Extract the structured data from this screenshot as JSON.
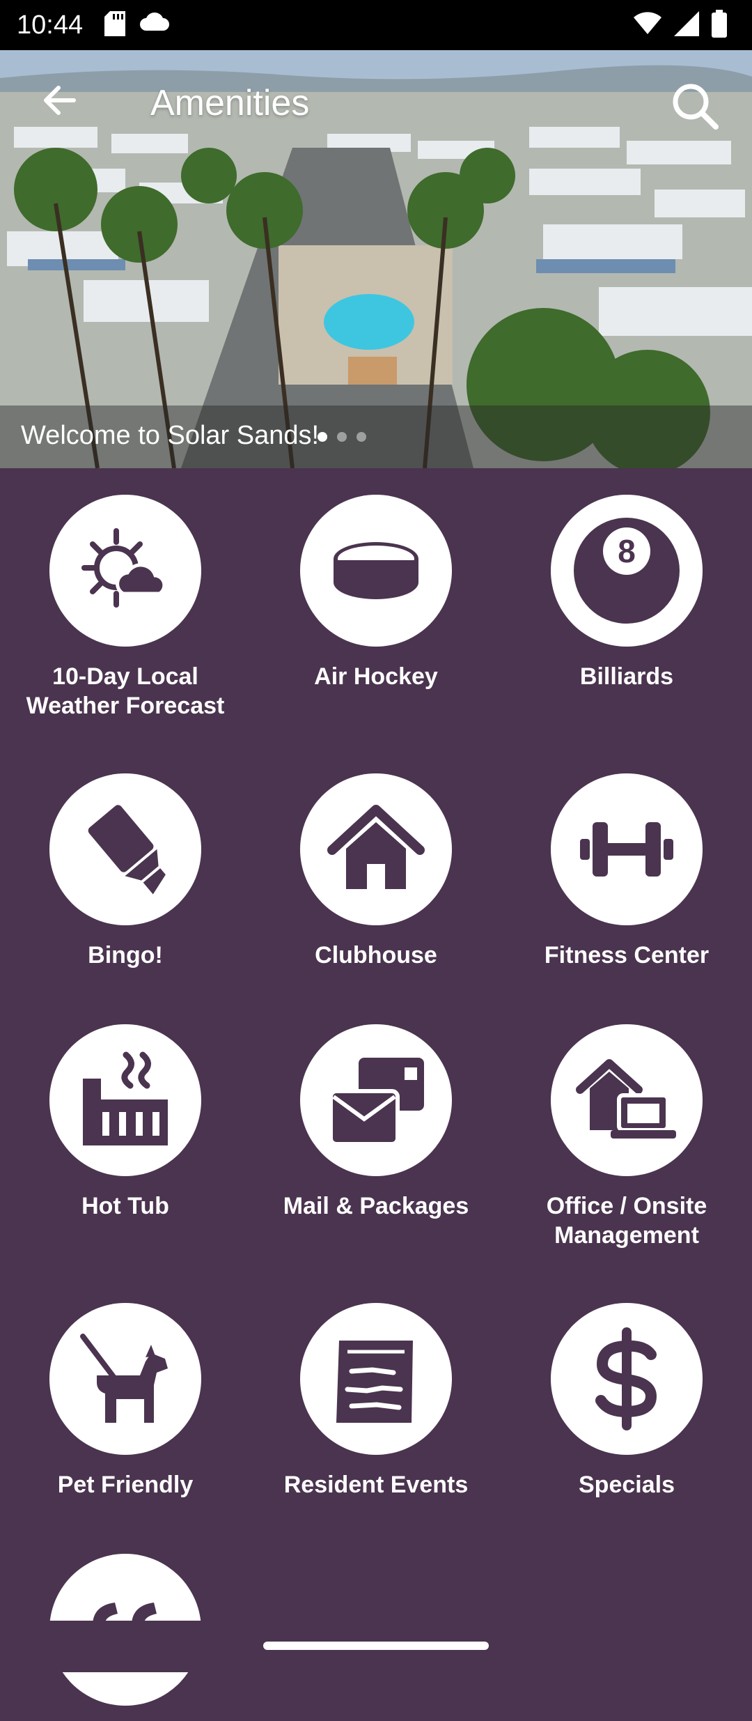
{
  "status": {
    "time": "10:44"
  },
  "header": {
    "title": "Amenities"
  },
  "hero": {
    "caption": "Welcome to Solar Sands!",
    "dot_count": 3,
    "active_dot": 0
  },
  "colors": {
    "background": "#4b344f",
    "icon": "#4b344f",
    "tile": "#ffffff"
  },
  "amenities": [
    {
      "label": "10-Day Local Weather Forecast",
      "icon": "weather-icon"
    },
    {
      "label": "Air Hockey",
      "icon": "puck-icon"
    },
    {
      "label": "Billiards",
      "icon": "eight-ball-icon"
    },
    {
      "label": "Bingo!",
      "icon": "highlighter-icon"
    },
    {
      "label": "Clubhouse",
      "icon": "house-icon"
    },
    {
      "label": "Fitness Center",
      "icon": "dumbbell-icon"
    },
    {
      "label": "Hot Tub",
      "icon": "hot-tub-icon"
    },
    {
      "label": "Mail & Packages",
      "icon": "mail-icon"
    },
    {
      "label": "Office / Onsite Management",
      "icon": "office-icon"
    },
    {
      "label": "Pet Friendly",
      "icon": "dog-icon"
    },
    {
      "label": "Resident Events",
      "icon": "events-icon"
    },
    {
      "label": "Specials",
      "icon": "dollar-icon"
    },
    {
      "label": "",
      "icon": "quote-icon"
    }
  ]
}
